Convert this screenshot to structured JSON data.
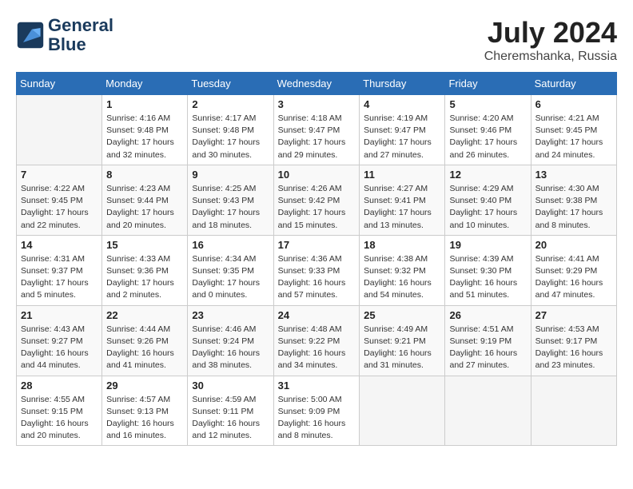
{
  "header": {
    "logo_line1": "General",
    "logo_line2": "Blue",
    "month_year": "July 2024",
    "location": "Cheremshanka, Russia"
  },
  "calendar": {
    "days_of_week": [
      "Sunday",
      "Monday",
      "Tuesday",
      "Wednesday",
      "Thursday",
      "Friday",
      "Saturday"
    ],
    "weeks": [
      [
        {
          "day": "",
          "info": ""
        },
        {
          "day": "1",
          "info": "Sunrise: 4:16 AM\nSunset: 9:48 PM\nDaylight: 17 hours\nand 32 minutes."
        },
        {
          "day": "2",
          "info": "Sunrise: 4:17 AM\nSunset: 9:48 PM\nDaylight: 17 hours\nand 30 minutes."
        },
        {
          "day": "3",
          "info": "Sunrise: 4:18 AM\nSunset: 9:47 PM\nDaylight: 17 hours\nand 29 minutes."
        },
        {
          "day": "4",
          "info": "Sunrise: 4:19 AM\nSunset: 9:47 PM\nDaylight: 17 hours\nand 27 minutes."
        },
        {
          "day": "5",
          "info": "Sunrise: 4:20 AM\nSunset: 9:46 PM\nDaylight: 17 hours\nand 26 minutes."
        },
        {
          "day": "6",
          "info": "Sunrise: 4:21 AM\nSunset: 9:45 PM\nDaylight: 17 hours\nand 24 minutes."
        }
      ],
      [
        {
          "day": "7",
          "info": "Sunrise: 4:22 AM\nSunset: 9:45 PM\nDaylight: 17 hours\nand 22 minutes."
        },
        {
          "day": "8",
          "info": "Sunrise: 4:23 AM\nSunset: 9:44 PM\nDaylight: 17 hours\nand 20 minutes."
        },
        {
          "day": "9",
          "info": "Sunrise: 4:25 AM\nSunset: 9:43 PM\nDaylight: 17 hours\nand 18 minutes."
        },
        {
          "day": "10",
          "info": "Sunrise: 4:26 AM\nSunset: 9:42 PM\nDaylight: 17 hours\nand 15 minutes."
        },
        {
          "day": "11",
          "info": "Sunrise: 4:27 AM\nSunset: 9:41 PM\nDaylight: 17 hours\nand 13 minutes."
        },
        {
          "day": "12",
          "info": "Sunrise: 4:29 AM\nSunset: 9:40 PM\nDaylight: 17 hours\nand 10 minutes."
        },
        {
          "day": "13",
          "info": "Sunrise: 4:30 AM\nSunset: 9:38 PM\nDaylight: 17 hours\nand 8 minutes."
        }
      ],
      [
        {
          "day": "14",
          "info": "Sunrise: 4:31 AM\nSunset: 9:37 PM\nDaylight: 17 hours\nand 5 minutes."
        },
        {
          "day": "15",
          "info": "Sunrise: 4:33 AM\nSunset: 9:36 PM\nDaylight: 17 hours\nand 2 minutes."
        },
        {
          "day": "16",
          "info": "Sunrise: 4:34 AM\nSunset: 9:35 PM\nDaylight: 17 hours\nand 0 minutes."
        },
        {
          "day": "17",
          "info": "Sunrise: 4:36 AM\nSunset: 9:33 PM\nDaylight: 16 hours\nand 57 minutes."
        },
        {
          "day": "18",
          "info": "Sunrise: 4:38 AM\nSunset: 9:32 PM\nDaylight: 16 hours\nand 54 minutes."
        },
        {
          "day": "19",
          "info": "Sunrise: 4:39 AM\nSunset: 9:30 PM\nDaylight: 16 hours\nand 51 minutes."
        },
        {
          "day": "20",
          "info": "Sunrise: 4:41 AM\nSunset: 9:29 PM\nDaylight: 16 hours\nand 47 minutes."
        }
      ],
      [
        {
          "day": "21",
          "info": "Sunrise: 4:43 AM\nSunset: 9:27 PM\nDaylight: 16 hours\nand 44 minutes."
        },
        {
          "day": "22",
          "info": "Sunrise: 4:44 AM\nSunset: 9:26 PM\nDaylight: 16 hours\nand 41 minutes."
        },
        {
          "day": "23",
          "info": "Sunrise: 4:46 AM\nSunset: 9:24 PM\nDaylight: 16 hours\nand 38 minutes."
        },
        {
          "day": "24",
          "info": "Sunrise: 4:48 AM\nSunset: 9:22 PM\nDaylight: 16 hours\nand 34 minutes."
        },
        {
          "day": "25",
          "info": "Sunrise: 4:49 AM\nSunset: 9:21 PM\nDaylight: 16 hours\nand 31 minutes."
        },
        {
          "day": "26",
          "info": "Sunrise: 4:51 AM\nSunset: 9:19 PM\nDaylight: 16 hours\nand 27 minutes."
        },
        {
          "day": "27",
          "info": "Sunrise: 4:53 AM\nSunset: 9:17 PM\nDaylight: 16 hours\nand 23 minutes."
        }
      ],
      [
        {
          "day": "28",
          "info": "Sunrise: 4:55 AM\nSunset: 9:15 PM\nDaylight: 16 hours\nand 20 minutes."
        },
        {
          "day": "29",
          "info": "Sunrise: 4:57 AM\nSunset: 9:13 PM\nDaylight: 16 hours\nand 16 minutes."
        },
        {
          "day": "30",
          "info": "Sunrise: 4:59 AM\nSunset: 9:11 PM\nDaylight: 16 hours\nand 12 minutes."
        },
        {
          "day": "31",
          "info": "Sunrise: 5:00 AM\nSunset: 9:09 PM\nDaylight: 16 hours\nand 8 minutes."
        },
        {
          "day": "",
          "info": ""
        },
        {
          "day": "",
          "info": ""
        },
        {
          "day": "",
          "info": ""
        }
      ]
    ]
  }
}
